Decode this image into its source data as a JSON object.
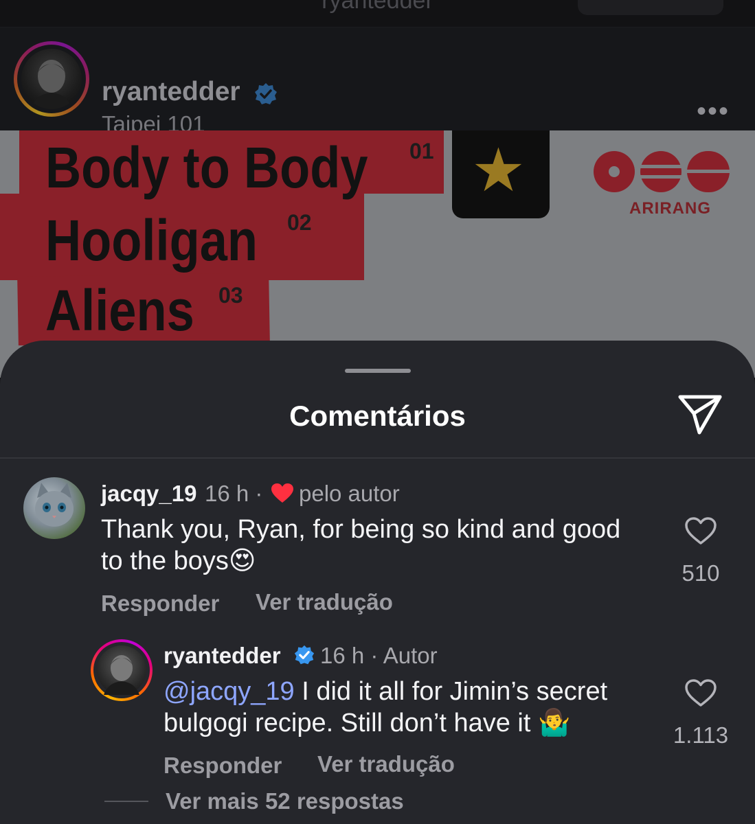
{
  "topbar": {
    "title": "ryantedder"
  },
  "post": {
    "username": "ryantedder",
    "location": "Taipei 101",
    "more": "•••",
    "tracks": [
      {
        "title": "Body to Body",
        "number": "01"
      },
      {
        "title": "Hooligan",
        "number": "02"
      },
      {
        "title": "Aliens",
        "number": "03"
      }
    ],
    "star": "★",
    "logo_text": "ARIRANG"
  },
  "sheet": {
    "title": "Comentários"
  },
  "comments": [
    {
      "username": "jacqy_19",
      "time": "16 h ·",
      "badge": "pelo autor",
      "text": "Thank you, Ryan, for being so kind and good to the boys",
      "emoji": "😍",
      "likes": "510",
      "reply_label": "Responder",
      "translate_label": "Ver tradução"
    },
    {
      "username": "ryantedder",
      "time": "16 h · Autor",
      "mention": "@jacqy_19",
      "text": " I did it all for Jimin’s secret bulgogi recipe.  Still don’t have it",
      "emoji": "🤷‍♂️",
      "likes": "1.113",
      "reply_label": "Responder",
      "translate_label": "Ver tradução"
    }
  ],
  "more_replies": "Ver mais 52 respostas",
  "colors": {
    "verified": "#3897f0",
    "heart": "#ff3040",
    "mention": "#8ea6ff"
  }
}
